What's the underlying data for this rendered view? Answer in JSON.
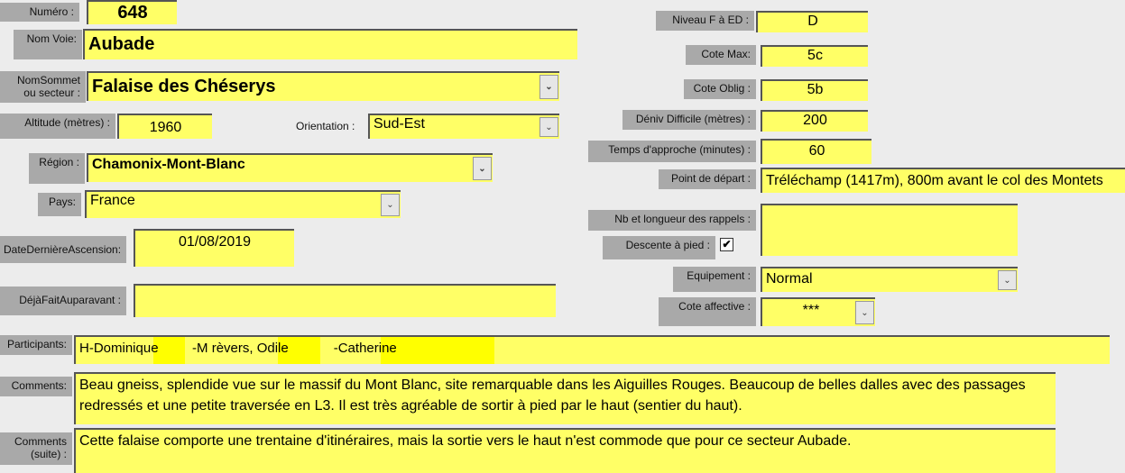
{
  "labels": {
    "numero": "Numéro :",
    "nom_voie": "Nom Voie:",
    "nom_sommet": "NomSommet ou secteur :",
    "altitude": "Altitude (mètres) :",
    "orientation": "Orientation :",
    "region": "Région :",
    "pays": "Pays:",
    "date": "DateDernièreAscension:",
    "deja": "DéjàFaitAuparavant :",
    "participants": "Participants:",
    "comments": "Comments:",
    "comments_suite": "Comments (suite) :",
    "niveau": "Niveau F à ED :",
    "cote_max": "Cote Max:",
    "cote_oblig": "Cote Oblig :",
    "deniv": "Déniv Difficile (mètres) :",
    "temps": "Temps d'approche (minutes) :",
    "depart": "Point de départ :",
    "rappels": "Nb et longueur des rappels :",
    "descente": "Descente à pied :",
    "equipement": "Equipement :",
    "cote_affective": "Cote affective :"
  },
  "values": {
    "numero": "648",
    "nom_voie": "Aubade",
    "nom_sommet": "Falaise des Chéserys",
    "altitude": "1960",
    "orientation": "Sud-Est",
    "region": "Chamonix-Mont-Blanc",
    "pays": "France",
    "date": "01/08/2019",
    "deja": "",
    "participants": "H-Dominique         -M rèvers, Odile            -Catherine",
    "comments": "Beau gneiss, splendide vue sur le massif du Mont Blanc, site remarquable dans les Aiguilles Rouges. Beaucoup de belles dalles avec des passages redressés et une petite traversée en L3. Il est très agréable de sortir à pied par le haut (sentier du haut).",
    "comments_suite": "Cette falaise comporte une trentaine d'itinéraires, mais la sortie vers le haut n'est commode que pour ce secteur Aubade.",
    "niveau": "D",
    "cote_max": "5c",
    "cote_oblig": "5b",
    "deniv": "200",
    "temps": "60",
    "depart": "Tréléchamp (1417m), 800m avant le col des Montets",
    "rappels": "",
    "descente_checked": true,
    "equipement": "Normal",
    "cote_affective": "***"
  },
  "icons": {
    "dropdown": "chevron-down-icon",
    "check": "checkmark-icon"
  },
  "colors": {
    "field": "#ffff66",
    "label": "#a9a9a9",
    "redaction": "#ffff00"
  }
}
